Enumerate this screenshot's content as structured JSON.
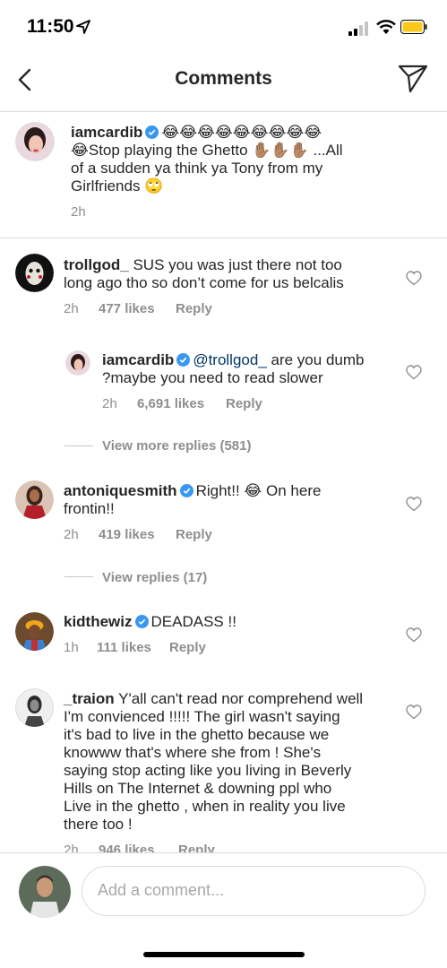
{
  "status": {
    "time": "11:50"
  },
  "header": {
    "title": "Comments"
  },
  "caption": {
    "username": "iamcardib",
    "text": "😂😂😂😂😂😂😂😂😂",
    "text2": "😂Stop playing the Ghetto ✋🏽✋🏽✋🏽 ...All",
    "text3": "of a sudden ya think ya Tony from my",
    "text4": "Girlfriends 🙄",
    "time": "2h"
  },
  "comments": [
    {
      "username": "trollgod_",
      "line1": "SUS you was just there not too",
      "line2": "long ago tho so don’t come for us belcalis",
      "time": "2h",
      "likes": "477 likes",
      "reply": "Reply"
    },
    {
      "username": "iamcardib",
      "mention": "@trollgod_",
      "line1": "are you dumb",
      "line2": "?maybe you need to read slower",
      "time": "2h",
      "likes": "6,691 likes",
      "reply": "Reply"
    },
    {
      "username": "antoniquesmith",
      "line1": "Right!! 😂  On here",
      "line2": "frontin!!",
      "time": "2h",
      "likes": "419 likes",
      "reply": "Reply"
    },
    {
      "username": "kidthewiz",
      "line1": "DEADASS !!",
      "time": "1h",
      "likes": "111 likes",
      "reply": "Reply"
    },
    {
      "username": "_traion",
      "lines": [
        "Y'all can't read nor comprehend well",
        "I'm convienced !!!!! The girl wasn't saying",
        "it's bad to live in the ghetto because we",
        "knowww that's where she from ! She's",
        "saying stop acting like you living in Beverly",
        "Hills on The Internet & downing ppl who",
        "Live in the ghetto , when in reality you live",
        "there too !"
      ],
      "time": "2h",
      "likes": "946 likes",
      "reply": "Reply"
    }
  ],
  "view_more_replies": "View more replies (581)",
  "view_replies": "View replies (17)",
  "composer": {
    "placeholder": "Add a comment..."
  },
  "colors": {
    "verified": "#3897f0",
    "meta": "#8e8e8e",
    "divider": "#dbdbdb"
  }
}
